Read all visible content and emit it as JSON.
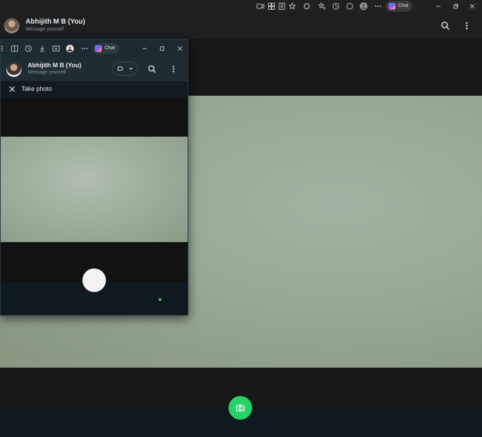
{
  "browser": {
    "copilot_label": "Chat",
    "icons": [
      "camera-icon",
      "apps-icon",
      "reader-icon",
      "favorite-icon",
      "extensions-icon",
      "favorites-list-icon",
      "history-icon",
      "copilot-icon",
      "profile-icon",
      "more-icon"
    ],
    "window_controls": [
      "minimize-icon",
      "restore-icon",
      "close-icon"
    ]
  },
  "chat": {
    "name": "Abhijith M B (You)",
    "subtitle": "Message yourself"
  },
  "popup": {
    "copilot_label": "Chat",
    "header_name": "Abhijith M B (You)",
    "header_subtitle": "Message yourself",
    "take_photo_label": "Take photo"
  },
  "colors": {
    "accent": "#25d366",
    "panel": "#1f2c33",
    "background": "#111b21",
    "text_primary": "#e9edef",
    "text_secondary": "#8696a0"
  }
}
